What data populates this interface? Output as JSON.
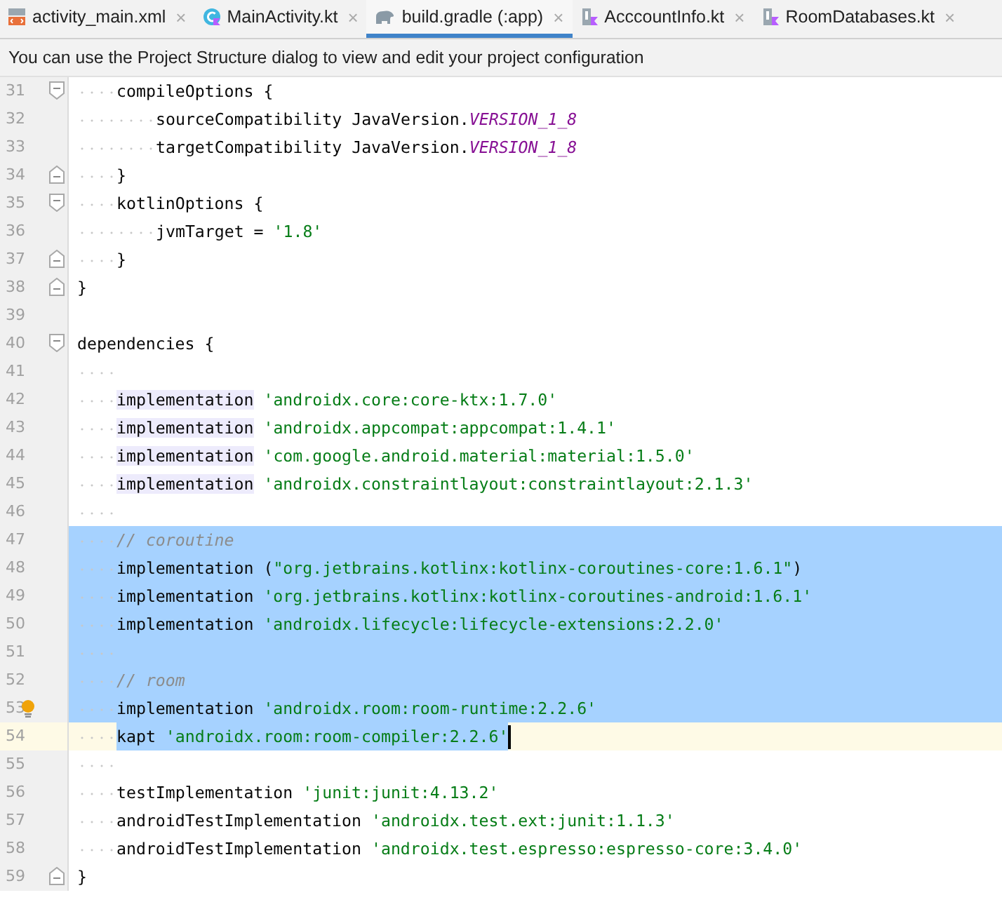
{
  "tabs": [
    {
      "label": "activity_main.xml",
      "kind": "xml",
      "selected": false,
      "close": "×"
    },
    {
      "label": "MainActivity.kt",
      "kind": "kotlin-class",
      "selected": false,
      "close": "×"
    },
    {
      "label": "build.gradle (:app)",
      "kind": "gradle",
      "selected": true,
      "close": "×"
    },
    {
      "label": "AcccountInfo.kt",
      "kind": "kotlin-file",
      "selected": false,
      "close": "×"
    },
    {
      "label": "RoomDatabases.kt",
      "kind": "kotlin-file",
      "selected": false,
      "close": "×"
    }
  ],
  "notification": "You can use the Project Structure dialog to view and edit your project configuration",
  "lines": [
    {
      "children": [
        {
          "number": "31",
          "fold_start": true,
          "fold_end": false,
          "bulb": false,
          "selected": false,
          "caret": false,
          "tokens": [
            {
              "kind": "plain",
              "text": "compileOptions {"
            }
          ],
          "children": [
            {
              "number": "32",
              "fold_start": false,
              "fold_end": false,
              "bulb": false,
              "selected": false,
              "caret": false,
              "tokens": [
                {
                  "kind": "plain",
                  "text": "sourceCompatibility JavaVersion."
                },
                {
                  "kind": "constant",
                  "text": "VERSION_1_8"
                }
              ]
            },
            {
              "number": "33",
              "fold_start": false,
              "fold_end": false,
              "bulb": false,
              "selected": false,
              "caret": false,
              "tokens": [
                {
                  "kind": "plain",
                  "text": "targetCompatibility JavaVersion."
                },
                {
                  "kind": "constant",
                  "text": "VERSION_1_8"
                }
              ]
            }
          ]
        },
        {
          "number": "34",
          "fold_start": false,
          "fold_end": true,
          "bulb": false,
          "selected": false,
          "caret": false,
          "tokens": [
            {
              "kind": "plain",
              "text": "}"
            }
          ]
        },
        {
          "number": "35",
          "fold_start": true,
          "fold_end": false,
          "bulb": false,
          "selected": false,
          "caret": false,
          "tokens": [
            {
              "kind": "plain",
              "text": "kotlinOptions {"
            }
          ],
          "children": [
            {
              "number": "36",
              "fold_start": false,
              "fold_end": false,
              "bulb": false,
              "selected": false,
              "caret": false,
              "tokens": [
                {
                  "kind": "plain",
                  "text": "jvmTarget = "
                },
                {
                  "kind": "string",
                  "text": "'1.8'"
                }
              ]
            }
          ]
        },
        {
          "number": "37",
          "fold_start": false,
          "fold_end": true,
          "bulb": false,
          "selected": false,
          "caret": false,
          "tokens": [
            {
              "kind": "plain",
              "text": "}"
            }
          ]
        }
      ]
    },
    {
      "number": "38",
      "fold_start": false,
      "fold_end": true,
      "bulb": false,
      "selected": false,
      "caret": false,
      "tokens": [
        {
          "kind": "plain",
          "text": "}"
        }
      ]
    },
    {
      "number": "39",
      "fold_start": false,
      "fold_end": false,
      "bulb": false,
      "selected": false,
      "caret": false
    },
    {
      "number": "40",
      "fold_start": true,
      "fold_end": false,
      "bulb": false,
      "selected": false,
      "caret": false,
      "tokens": [
        {
          "kind": "plain",
          "text": "dependencies {"
        }
      ],
      "children": [
        {
          "number": "41",
          "fold_start": false,
          "fold_end": false,
          "bulb": false,
          "selected": false,
          "caret": false
        },
        {
          "number": "42",
          "fold_start": false,
          "fold_end": false,
          "bulb": false,
          "selected": false,
          "caret": false,
          "tokens": [
            {
              "kind": "marked",
              "text": "implementation"
            },
            {
              "kind": "string",
              "text": " 'androidx.core:core-ktx:1.7.0'"
            }
          ]
        },
        {
          "number": "43",
          "fold_start": false,
          "fold_end": false,
          "bulb": false,
          "selected": false,
          "caret": false,
          "tokens": [
            {
              "kind": "marked",
              "text": "implementation"
            },
            {
              "kind": "string",
              "text": " 'androidx.appcompat:appcompat:1.4.1'"
            }
          ]
        },
        {
          "number": "44",
          "fold_start": false,
          "fold_end": false,
          "bulb": false,
          "selected": false,
          "caret": false,
          "tokens": [
            {
              "kind": "marked",
              "text": "implementation"
            },
            {
              "kind": "string",
              "text": " 'com.google.android.material:material:1.5.0'"
            }
          ]
        },
        {
          "number": "45",
          "fold_start": false,
          "fold_end": false,
          "bulb": false,
          "selected": false,
          "caret": false,
          "tokens": [
            {
              "kind": "marked",
              "text": "implementation"
            },
            {
              "kind": "string",
              "text": " 'androidx.constraintlayout:constraintlayout:2.1.3'"
            }
          ]
        },
        {
          "number": "46",
          "fold_start": false,
          "fold_end": false,
          "bulb": false,
          "selected": false,
          "caret": false
        },
        {
          "number": "47",
          "fold_start": false,
          "fold_end": false,
          "bulb": false,
          "selected": true,
          "caret": false,
          "tokens": [
            {
              "kind": "comment",
              "text": "// coroutine"
            }
          ]
        },
        {
          "number": "48",
          "fold_start": false,
          "fold_end": false,
          "bulb": false,
          "selected": true,
          "caret": false,
          "tokens": [
            {
              "kind": "plain",
              "text": "implementation ("
            },
            {
              "kind": "string",
              "text": "\"org.jetbrains.kotlinx:kotlinx-coroutines-core:1.6.1\""
            },
            {
              "kind": "plain",
              "text": ")"
            }
          ]
        },
        {
          "number": "49",
          "fold_start": false,
          "fold_end": false,
          "bulb": false,
          "selected": true,
          "caret": false,
          "tokens": [
            {
              "kind": "plain",
              "text": "implementation "
            },
            {
              "kind": "string",
              "text": "'org.jetbrains.kotlinx:kotlinx-coroutines-android:1.6.1'"
            }
          ]
        },
        {
          "number": "50",
          "fold_start": false,
          "fold_end": false,
          "bulb": false,
          "selected": true,
          "caret": false,
          "tokens": [
            {
              "kind": "plain",
              "text": "implementation "
            },
            {
              "kind": "string",
              "text": "'androidx.lifecycle:lifecycle-extensions:2.2.0'"
            }
          ]
        },
        {
          "number": "51",
          "fold_start": false,
          "fold_end": false,
          "bulb": false,
          "selected": true,
          "caret": false
        },
        {
          "number": "52",
          "fold_start": false,
          "fold_end": false,
          "bulb": false,
          "selected": true,
          "caret": false,
          "tokens": [
            {
              "kind": "comment",
              "text": "// room"
            }
          ]
        },
        {
          "number": "53",
          "fold_start": false,
          "fold_end": false,
          "bulb": true,
          "selected": true,
          "caret": false,
          "tokens": [
            {
              "kind": "plain",
              "text": "implementation "
            },
            {
              "kind": "string",
              "text": "'androidx.room:room-runtime:2.2.6'"
            }
          ]
        },
        {
          "number": "54",
          "fold_start": false,
          "fold_end": false,
          "bulb": false,
          "selected": true,
          "caret": true,
          "tokens": [
            {
              "kind": "plain",
              "text": "kapt "
            },
            {
              "kind": "string",
              "text": "'androidx.room:room-compiler:2.2.6'"
            }
          ]
        },
        {
          "number": "55",
          "fold_start": false,
          "fold_end": false,
          "bulb": false,
          "selected": false,
          "caret": false
        },
        {
          "number": "56",
          "fold_start": false,
          "fold_end": false,
          "bulb": false,
          "selected": false,
          "caret": false,
          "tokens": [
            {
              "kind": "plain",
              "text": "testImplementation "
            },
            {
              "kind": "string",
              "text": "'junit:junit:4.13.2'"
            }
          ]
        },
        {
          "number": "57",
          "fold_start": false,
          "fold_end": false,
          "bulb": false,
          "selected": false,
          "caret": false,
          "tokens": [
            {
              "kind": "plain",
              "text": "androidTestImplementation "
            },
            {
              "kind": "string",
              "text": "'androidx.test.ext:junit:1.1.3'"
            }
          ]
        },
        {
          "number": "58",
          "fold_start": false,
          "fold_end": false,
          "bulb": false,
          "selected": false,
          "caret": false,
          "tokens": [
            {
              "kind": "plain",
              "text": "androidTestImplementation "
            },
            {
              "kind": "string",
              "text": "'androidx.test.espresso:espresso-core:3.4.0'"
            }
          ]
        }
      ]
    },
    {
      "number": "59",
      "fold_start": false,
      "fold_end": true,
      "bulb": false,
      "selected": false,
      "caret": false,
      "tokens": [
        {
          "kind": "plain",
          "text": "}"
        }
      ]
    }
  ]
}
